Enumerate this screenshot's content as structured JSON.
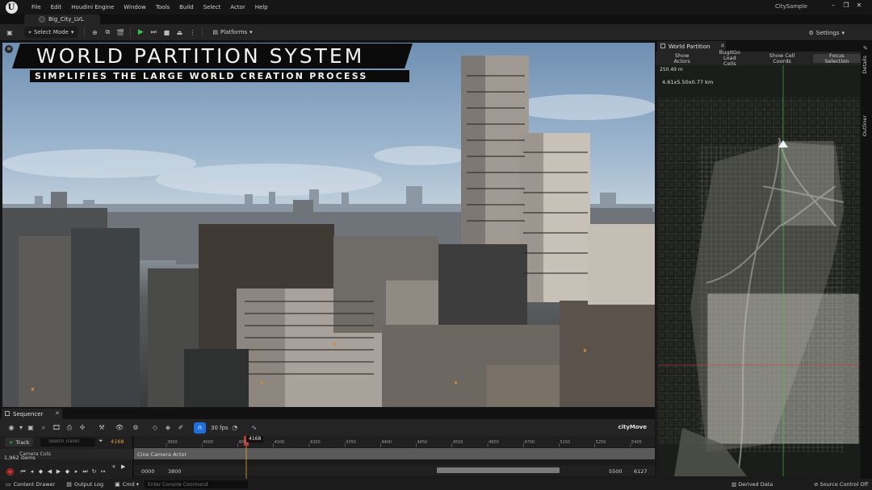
{
  "app": {
    "project_name": "CitySample",
    "level_tab": "Big_City_LVL",
    "menus": [
      "File",
      "Edit",
      "Houdini Engine",
      "Window",
      "Tools",
      "Build",
      "Select",
      "Actor",
      "Help"
    ]
  },
  "toolbar": {
    "select_mode": "Select Mode",
    "platforms": "Platforms",
    "settings": "Settings"
  },
  "viewport": {
    "title": "WORLD PARTITION SYSTEM",
    "subtitle": "SIMPLIFIES THE LARGE WORLD CREATION PROCESS"
  },
  "world_partition": {
    "tab": "World Partition",
    "show_actors": "Show Actors",
    "bug_it_go_line1": "BugItGo Load",
    "bug_it_go_line2": "Cells",
    "show_cell_coords": "Show Cell Coords",
    "focus_selection": "Focus Selection",
    "scale_label": "250.49 m",
    "size_label": "4.61x5.50x0.77 km"
  },
  "side_tabs": {
    "details": "Details",
    "outliner": "Outliner"
  },
  "sequencer": {
    "tab": "Sequencer",
    "fps": "30 fps",
    "actor": "cityMove",
    "track_button": "Track",
    "search_placeholder": "Search Tracks",
    "current_frame": "4168",
    "track_name": "Camera Cuts",
    "item_count": "1,962 items",
    "clip_label": "Cine Camera Actor",
    "ticks": [
      "3900",
      "4000",
      "4050",
      "4100",
      "4200",
      "4350",
      "4400",
      "4450",
      "4500",
      "4600",
      "4700",
      "5150",
      "5250",
      "5400"
    ],
    "range_start": "0000",
    "view_start": "3800",
    "view_end": "5500",
    "range_end": "6127"
  },
  "statusbar": {
    "content_drawer": "Content Drawer",
    "output_log": "Output Log",
    "cmd": "Cmd",
    "console_placeholder": "Enter Console Command",
    "derived_data": "Derived Data",
    "source_control": "Source Control Off"
  },
  "colors": {
    "accent_blue": "#1f6fdc",
    "play_green": "#36c24a",
    "playhead_orange": "#e6a23c",
    "record_red": "#dd3333"
  }
}
